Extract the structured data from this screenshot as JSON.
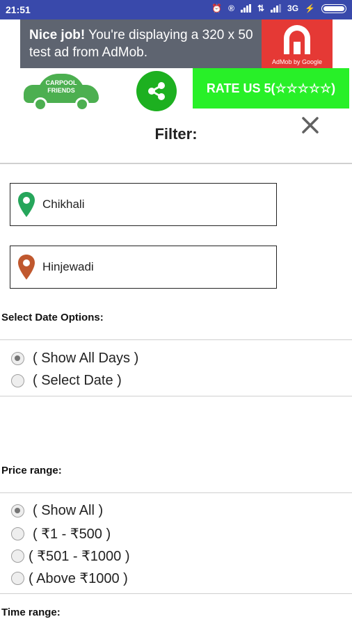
{
  "status_bar": {
    "time": "21:51",
    "network": "3G",
    "icons": [
      "alarm-icon",
      "r-circle-icon",
      "signal-icon",
      "data-icon",
      "signal-icon",
      "charging-icon",
      "battery-icon"
    ]
  },
  "ad": {
    "headline": "Nice job!",
    "body": "You're displaying a 320 x 50 test ad from AdMob.",
    "brand": "AdMob by Google"
  },
  "header": {
    "logo_text_line1": "CARPOOL",
    "logo_text_line2": "FRIENDS",
    "rate_label": "RATE US 5(☆☆☆☆☆)"
  },
  "filter": {
    "title": "Filter:",
    "from_location": "Chikhali",
    "to_location": "Hinjewadi"
  },
  "date_options": {
    "label": "Select Date Options:",
    "options": [
      "( Show All Days )",
      "( Select Date )"
    ],
    "selected_index": 0
  },
  "price_range": {
    "label": "Price range:",
    "options": [
      "( Show All )",
      "( ₹1 - ₹500 )",
      "( ₹501 - ₹1000 )",
      "( Above ₹1000 )"
    ],
    "selected_index": 0
  },
  "time_range": {
    "label": "Time range:"
  },
  "colors": {
    "status_bar": "#3949ab",
    "ad_background": "#5e6470",
    "ad_logo": "#e53935",
    "brand_green": "#4caf50",
    "share_green": "#1db020",
    "rate_green": "#28f028",
    "from_pin": "#26a65b",
    "to_pin": "#c0582e"
  }
}
